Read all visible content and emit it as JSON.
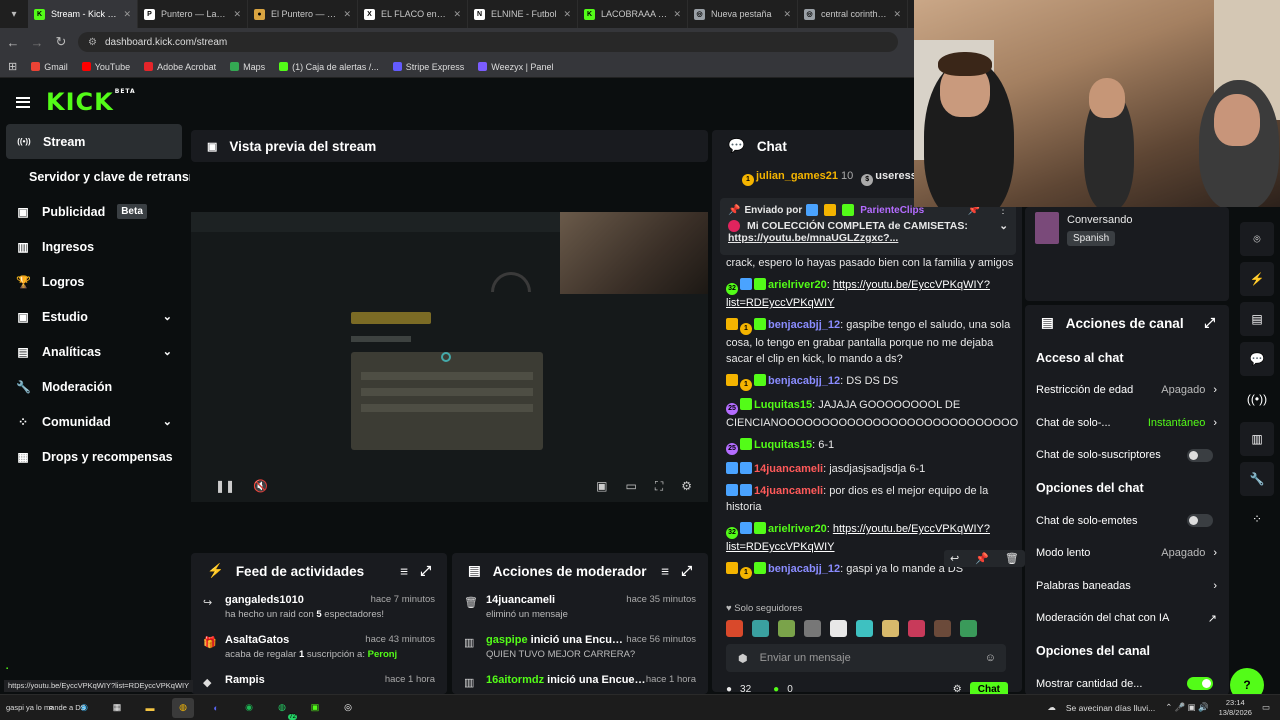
{
  "browser": {
    "tabs": [
      {
        "label": "Stream - Kick Da",
        "color": "#53fc18",
        "glyph": "K"
      },
      {
        "label": "Puntero — La cal",
        "color": "#ffffff",
        "glyph": "P"
      },
      {
        "label": "El Puntero — En",
        "color": "#d9a441",
        "glyph": "●"
      },
      {
        "label": "EL FLACO en X: \"",
        "color": "#ffffff",
        "glyph": "X"
      },
      {
        "label": "ELNINE - Futbol",
        "color": "#ffffff",
        "glyph": "N"
      },
      {
        "label": "LACOBRAAA Stre",
        "color": "#53fc18",
        "glyph": "K"
      },
      {
        "label": "Nueva pestaña",
        "color": "#9aa0a6",
        "glyph": "◎"
      },
      {
        "label": "central corinthian",
        "color": "#9aa0a6",
        "glyph": "◎"
      }
    ],
    "url": "dashboard.kick.com/stream",
    "bookmarks": [
      {
        "label": "Gmail",
        "color": "#ea4335"
      },
      {
        "label": "YouTube",
        "color": "#ff0000"
      },
      {
        "label": "Adobe Acrobat",
        "color": "#e5252a"
      },
      {
        "label": "Maps",
        "color": "#34a853"
      },
      {
        "label": "(1) Caja de alertas /...",
        "color": "#53fc18"
      },
      {
        "label": "Stripe Express",
        "color": "#635bff"
      },
      {
        "label": "Weezyx | Panel",
        "color": "#7b5cff"
      }
    ]
  },
  "brand": {
    "logo": "KICK",
    "logo_badge": "BETA",
    "accent": "#53fc18"
  },
  "sidebar": {
    "items": [
      {
        "label": "Stream",
        "icon": "broadcast-icon"
      },
      {
        "label": "Servidor y clave de retransmisión",
        "icon": ""
      },
      {
        "label": "Publicidad",
        "icon": "ad-icon",
        "badge": "Beta"
      },
      {
        "label": "Ingresos",
        "icon": "revenue-icon"
      },
      {
        "label": "Logros",
        "icon": "trophy-icon"
      },
      {
        "label": "Estudio",
        "icon": "studio-icon"
      },
      {
        "label": "Analíticas",
        "icon": "analytics-icon"
      },
      {
        "label": "Moderación",
        "icon": "wrench-icon"
      },
      {
        "label": "Comunidad",
        "icon": "community-icon"
      },
      {
        "label": "Drops y recompensas",
        "icon": "drops-icon"
      }
    ]
  },
  "preview": {
    "title": "Vista previa del stream"
  },
  "feed": {
    "title": "Feed de actividades",
    "items": [
      {
        "name": "gangaleds1010",
        "time": "hace 7 minutos",
        "sub_pre": "ha hecho un raid con ",
        "sub_num": "5",
        "sub_post": " espectadores!"
      },
      {
        "name": "AsaltaGatos",
        "time": "hace 43 minutos",
        "sub_pre": "acaba de regalar ",
        "sub_num": "1",
        "sub_post": " suscripción a: ",
        "sub_user": "Peronj"
      },
      {
        "name": "Rampis",
        "time": "hace 1 hora",
        "sub_pre": "",
        "sub_num": "",
        "sub_post": ""
      }
    ]
  },
  "modactions": {
    "title": "Acciones de moderador",
    "items": [
      {
        "name": "14juancameli",
        "action": "",
        "time": "hace 35 minutos",
        "sub": "eliminó un mensaje"
      },
      {
        "name": "gaspipe",
        "action": " inició una Encuesta",
        "time": "hace 56 minutos",
        "sub": "QUIEN TUVO MEJOR CARRERA?"
      },
      {
        "name": "16aitormdz",
        "action": " inició una Encuesta",
        "time": "hace 1 hora",
        "sub": ""
      }
    ]
  },
  "chat": {
    "title": "Chat",
    "top_users": [
      {
        "name": "julian_games21",
        "count": "10"
      },
      {
        "name": "useress",
        "count": ""
      }
    ],
    "pinned": {
      "by_label": "Enviado por",
      "by_user": "ParienteClips",
      "text": "Mi COLECCIÓN COMPLETA de CAMISETAS:",
      "link": "https://youtu.be/mnaUGLZzgxc?..."
    },
    "messages": [
      {
        "user": "",
        "color": "#ffffff",
        "text": "crack, espero lo hayas pasado bien con la familia y amigos",
        "link": false
      },
      {
        "user": "arielriver20",
        "color": "#53fc18",
        "text": "https://youtu.be/EyccVPKqWIY?list=RDEyccVPKqWIY",
        "link": true
      },
      {
        "user": "benjacabjj_12",
        "color": "#8a8cff",
        "text": "gaspibe tengo el saludo, una sola cosa, lo tengo en grabar pantalla porque no me dejaba sacar el clip en kick, lo mando a ds?",
        "link": false
      },
      {
        "user": "benjacabjj_12",
        "color": "#8a8cff",
        "text": "DS DS DS",
        "link": false
      },
      {
        "user": "Luquitas15",
        "color": "#53fc18",
        "text": "JAJAJA GOOOOOOOOL DE CIENCIANOOOOOOOOOOOOOOOOOOOOOOOOOOOO",
        "link": false
      },
      {
        "user": "Luquitas15",
        "color": "#53fc18",
        "text": "6-1",
        "link": false
      },
      {
        "user": "14juancameli",
        "color": "#ff5a5a",
        "text": "jasdjasjsadjsdja 6-1",
        "link": false
      },
      {
        "user": "14juancameli",
        "color": "#ff5a5a",
        "text": "por dios es el mejor equipo de la historia",
        "link": false
      },
      {
        "user": "arielriver20",
        "color": "#53fc18",
        "text": "https://youtu.be/EyccVPKqWIY?list=RDEyccVPKqWIY",
        "link": true
      },
      {
        "user": "benjacabjj_12",
        "color": "#8a8cff",
        "text": "gaspi ya lo mande a DS",
        "link": false
      }
    ],
    "followers_only": "Solo seguidores",
    "input_placeholder": "Enviar un mensaje",
    "send_label": "Chat",
    "footer_count_a": "32",
    "footer_count_b": "0"
  },
  "stream_info": {
    "category": "Conversando",
    "language": "Spanish"
  },
  "channel_actions": {
    "title": "Acciones de canal",
    "sections": [
      {
        "title": "Acceso al chat",
        "rows": [
          {
            "label": "Restricción de edad",
            "value": "Apagado",
            "kind": "chevron"
          },
          {
            "label": "Chat de solo-...",
            "value": "Instantáneo",
            "kind": "chevron",
            "green": true
          },
          {
            "label": "Chat de solo-suscriptores",
            "value": "",
            "kind": "toggle",
            "on": false
          }
        ]
      },
      {
        "title": "Opciones del chat",
        "rows": [
          {
            "label": "Chat de solo-emotes",
            "value": "",
            "kind": "toggle",
            "on": false
          },
          {
            "label": "Modo lento",
            "value": "Apagado",
            "kind": "chevron"
          },
          {
            "label": "Palabras baneadas",
            "value": "",
            "kind": "chevron"
          },
          {
            "label": "Moderación del chat con IA",
            "value": "",
            "kind": "external"
          }
        ]
      },
      {
        "title": "Opciones del canal",
        "rows": [
          {
            "label": "Mostrar cantidad de...",
            "value": "",
            "kind": "toggle",
            "on": true
          }
        ]
      }
    ]
  },
  "taskbar": {
    "weather": "Se avecinan días lluvi...",
    "time": "23:14",
    "date": "13/8/2026",
    "whatsapp_badge": "72"
  },
  "tooltip": "https://youtu.be/EyccVPKqWIY?list=RDEyccVPKqWIY",
  "desktop_note": "gaspi ya lo mande a DS"
}
